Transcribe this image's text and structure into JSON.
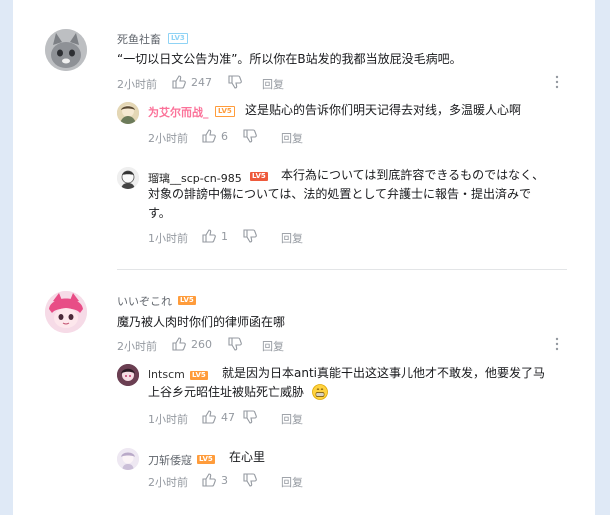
{
  "comments": [
    {
      "user": "死鱼社畜",
      "level": "LV3",
      "text": "“一切以日文公告为准”。所以你在B站发的我都当放屁没毛病吧。",
      "time": "2小时前",
      "likes": "247",
      "reply_label": "回复",
      "replies": [
        {
          "user": "为艾尔而战_",
          "level": "LV5",
          "text": "这是贴心的告诉你们明天记得去对线，多温暖人心啊",
          "time": "2小时前",
          "likes": "6",
          "reply_label": "回复"
        },
        {
          "user": "瑠璃__scp-cn-985",
          "level": "LV5",
          "text_line1": "本行為については到底許容できるものではなく、",
          "text_line2": "対象の誹謗中傷については、法的処置として弁護士に報告・提出済みで",
          "text_line3": "す。",
          "time": "1小时前",
          "likes": "1",
          "reply_label": "回复"
        }
      ]
    },
    {
      "user": "いいぞこれ",
      "level": "LV5",
      "text": "魔乃被人肉时你们的律师函在哪",
      "time": "2小时前",
      "likes": "260",
      "reply_label": "回复",
      "replies": [
        {
          "user": "lntscm",
          "level": "LV5",
          "text_line1": "就是因为日本anti真能干出这这事儿他才不敢发，他要发了马",
          "text_line2": "上谷乡元昭住址被贴死亡威胁",
          "time": "1小时前",
          "likes": "47",
          "reply_label": "回复"
        },
        {
          "user": "刀斩倭寇",
          "level": "LV5",
          "text": "在心里",
          "time": "2小时前",
          "likes": "3",
          "reply_label": "回复"
        }
      ]
    }
  ],
  "icons": {
    "like": "thumbs-up-icon",
    "dislike": "thumbs-down-icon",
    "more": "more-vertical-icon",
    "emoji": "grin-emoji-icon"
  }
}
